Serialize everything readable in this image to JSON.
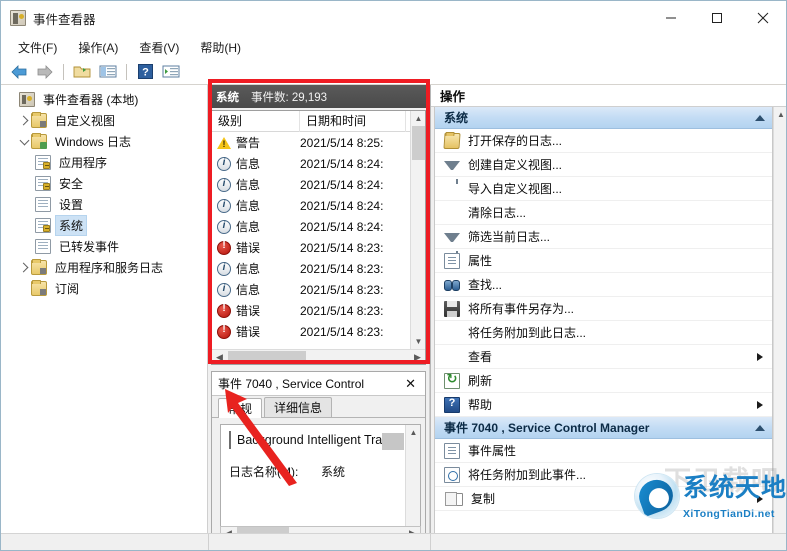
{
  "window": {
    "title": "事件查看器",
    "icon": "event-viewer-icon",
    "controls": {
      "minimize": "—",
      "maximize": "□",
      "close": "✕"
    }
  },
  "menubar": {
    "items": [
      {
        "label": "文件(F)"
      },
      {
        "label": "操作(A)"
      },
      {
        "label": "查看(V)"
      },
      {
        "label": "帮助(H)"
      }
    ]
  },
  "toolbar": {
    "buttons": [
      {
        "name": "back-icon"
      },
      {
        "name": "forward-icon"
      },
      {
        "name": "open-folder-icon"
      },
      {
        "name": "show-pane-icon"
      },
      {
        "name": "help-icon"
      },
      {
        "name": "show-action-pane-icon"
      }
    ]
  },
  "tree": {
    "items": [
      {
        "label": "事件查看器 (本地)",
        "icon": "event-viewer-icon",
        "twisty": "none",
        "indent": 0,
        "selected": false
      },
      {
        "label": "自定义视图",
        "icon": "folder-icon",
        "twisty": "collapsed",
        "indent": 1,
        "selected": false
      },
      {
        "label": "Windows 日志",
        "icon": "folder-icon",
        "twisty": "expanded",
        "indent": 1,
        "selected": false
      },
      {
        "label": "应用程序",
        "icon": "log-key-icon",
        "twisty": "none",
        "indent": 2,
        "selected": false
      },
      {
        "label": "安全",
        "icon": "log-key-icon",
        "twisty": "none",
        "indent": 2,
        "selected": false
      },
      {
        "label": "设置",
        "icon": "log-icon",
        "twisty": "none",
        "indent": 2,
        "selected": false
      },
      {
        "label": "系统",
        "icon": "log-key-icon",
        "twisty": "none",
        "indent": 2,
        "selected": true
      },
      {
        "label": "已转发事件",
        "icon": "log-icon",
        "twisty": "none",
        "indent": 2,
        "selected": false
      },
      {
        "label": "应用程序和服务日志",
        "icon": "folder-icon",
        "twisty": "collapsed",
        "indent": 1,
        "selected": false
      },
      {
        "label": "订阅",
        "icon": "folder-icon",
        "twisty": "none",
        "indent": 1,
        "selected": false
      }
    ]
  },
  "list": {
    "header_title": "系统",
    "header_count": "事件数: 29,193",
    "columns": [
      "级别",
      "日期和时间"
    ],
    "rows": [
      {
        "level": "警告",
        "severity": "warning",
        "datetime": "2021/5/14 8:25:"
      },
      {
        "level": "信息",
        "severity": "info",
        "datetime": "2021/5/14 8:24:"
      },
      {
        "level": "信息",
        "severity": "info",
        "datetime": "2021/5/14 8:24:"
      },
      {
        "level": "信息",
        "severity": "info",
        "datetime": "2021/5/14 8:24:"
      },
      {
        "level": "信息",
        "severity": "info",
        "datetime": "2021/5/14 8:24:"
      },
      {
        "level": "错误",
        "severity": "error",
        "datetime": "2021/5/14 8:23:"
      },
      {
        "level": "信息",
        "severity": "info",
        "datetime": "2021/5/14 8:23:"
      },
      {
        "level": "信息",
        "severity": "info",
        "datetime": "2021/5/14 8:23:"
      },
      {
        "level": "错误",
        "severity": "error",
        "datetime": "2021/5/14 8:23:"
      },
      {
        "level": "错误",
        "severity": "error",
        "datetime": "2021/5/14 8:23:"
      }
    ]
  },
  "detail": {
    "title": "事件 7040 , Service Control",
    "close_label": "✕",
    "tabs": [
      {
        "label": "常规",
        "active": true
      },
      {
        "label": "详细信息",
        "active": false
      }
    ],
    "message": "Background Intelligent Tran",
    "fields": [
      {
        "key": "日志名称(M):",
        "value": "系统"
      }
    ]
  },
  "actions": {
    "title": "操作",
    "sections": [
      {
        "title": "系统",
        "items": [
          {
            "label": "打开保存的日志...",
            "icon": "open-folder-icon",
            "submenu": false
          },
          {
            "label": "创建自定义视图...",
            "icon": "funnel-icon",
            "submenu": false
          },
          {
            "label": "导入自定义视图...",
            "icon": "none",
            "submenu": false
          },
          {
            "label": "清除日志...",
            "icon": "none",
            "submenu": false
          },
          {
            "label": "筛选当前日志...",
            "icon": "funnel-icon",
            "submenu": false
          },
          {
            "label": "属性",
            "icon": "properties-icon",
            "submenu": false
          },
          {
            "label": "查找...",
            "icon": "find-icon",
            "submenu": false
          },
          {
            "label": "将所有事件另存为...",
            "icon": "save-icon",
            "submenu": false
          },
          {
            "label": "将任务附加到此日志...",
            "icon": "none",
            "submenu": false
          },
          {
            "label": "查看",
            "icon": "none",
            "submenu": true
          },
          {
            "label": "刷新",
            "icon": "refresh-icon",
            "submenu": false
          },
          {
            "label": "帮助",
            "icon": "help-icon",
            "submenu": true
          }
        ]
      },
      {
        "title": "事件 7040 , Service Control Manager",
        "items": [
          {
            "label": "事件属性",
            "icon": "properties-icon",
            "submenu": false
          },
          {
            "label": "将任务附加到此事件...",
            "icon": "clock-icon",
            "submenu": false
          },
          {
            "label": "复制",
            "icon": "copy-icon",
            "submenu": true
          }
        ]
      }
    ]
  },
  "watermark": {
    "name": "系统天地",
    "url": "XiTongTianDi.net",
    "ghost": "下卫载吧"
  },
  "colors": {
    "annotation_red": "#ee1c23",
    "header_gray": "#4f4f4f",
    "section_blue": "#b3d3f0",
    "selection_blue": "#cde2f5"
  }
}
